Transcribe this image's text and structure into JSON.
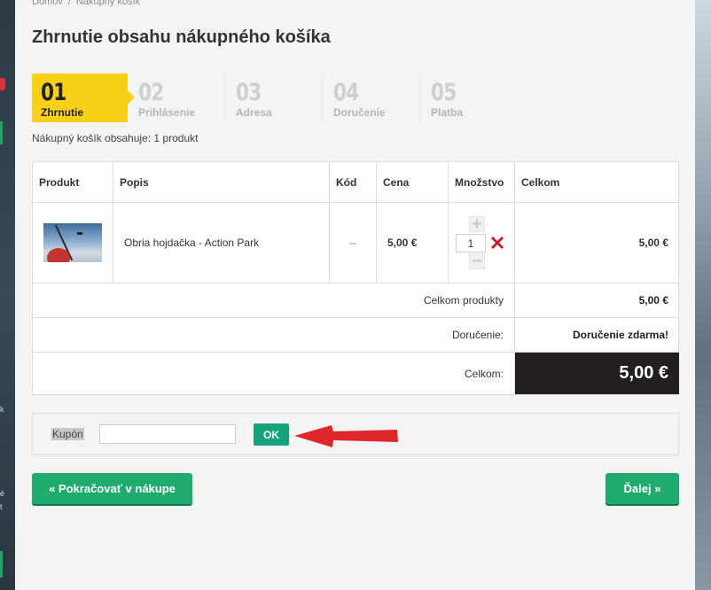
{
  "breadcrumb": {
    "home": "Domov",
    "separator": "/",
    "current": "Nákupný košík"
  },
  "title": "Zhrnutie obsahu nákupného košíka",
  "steps": [
    {
      "num": "01",
      "label": "Zhrnutie",
      "active": true
    },
    {
      "num": "02",
      "label": "Prihlásenie",
      "active": false
    },
    {
      "num": "03",
      "label": "Adresa",
      "active": false
    },
    {
      "num": "04",
      "label": "Doručenie",
      "active": false
    },
    {
      "num": "05",
      "label": "Platba",
      "active": false
    }
  ],
  "cart_summary": "Nákupný košík obsahuje: 1 produkt",
  "table": {
    "headers": {
      "product": "Produkt",
      "description": "Popis",
      "code": "Kód",
      "price": "Cena",
      "quantity": "Množstvo",
      "total": "Celkom"
    },
    "items": [
      {
        "description": "Obria hojdačka - Action Park",
        "code": "--",
        "price": "5,00 €",
        "quantity": "1",
        "total": "5,00 €"
      }
    ],
    "summary": {
      "products_label": "Celkom produkty",
      "products_value": "5,00 €",
      "shipping_label": "Doručenie:",
      "shipping_value": "Doručenie zdarma!",
      "total_label": "Celkom:",
      "total_value": "5,00 €"
    }
  },
  "coupon": {
    "label": "Kupón",
    "input_value": "",
    "button": "OK"
  },
  "buttons": {
    "continue_shopping": "« Pokračovať v nákupe",
    "next": "Ďalej »"
  },
  "colors": {
    "accent_yellow": "#f7d117",
    "green": "#1faa6f",
    "dark_total": "#231f20",
    "arrow_red": "#e0262b",
    "delete_red": "#d4161c"
  },
  "left_edge_fragments": {
    "k": "k",
    "e": "é",
    "t": "t"
  }
}
